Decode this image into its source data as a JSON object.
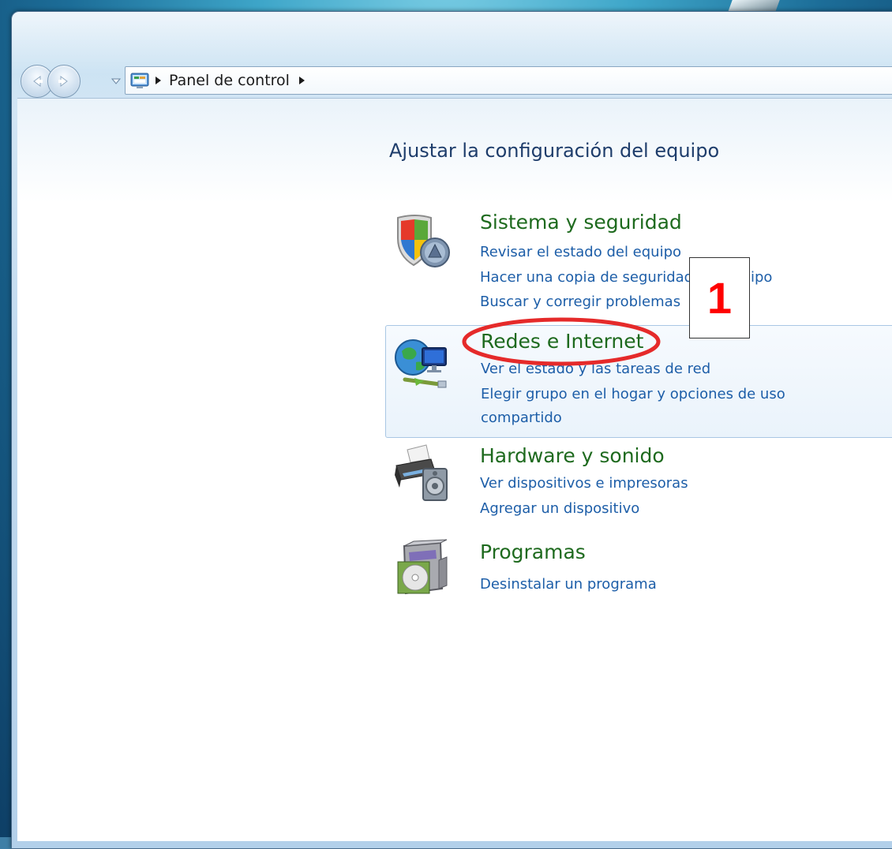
{
  "address_bar": {
    "crumb": "Panel de control"
  },
  "main": {
    "title": "Ajustar la configuración del equipo",
    "categories": [
      {
        "title": "Sistema y seguridad",
        "links": [
          "Revisar el estado del equipo",
          "Hacer una copia de seguridad del equipo",
          "Buscar y corregir problemas"
        ]
      },
      {
        "title": "Redes e Internet",
        "links": [
          "Ver el estado y las tareas de red",
          "Elegir grupo en el hogar y opciones de uso",
          "compartido"
        ]
      },
      {
        "title": "Hardware y sonido",
        "links": [
          "Ver dispositivos e impresoras",
          "Agregar un dispositivo"
        ]
      },
      {
        "title": "Programas",
        "links": [
          "Desinstalar un programa"
        ]
      }
    ]
  },
  "annotation": {
    "step_number": "1",
    "highlight_color": "#ff0000"
  }
}
